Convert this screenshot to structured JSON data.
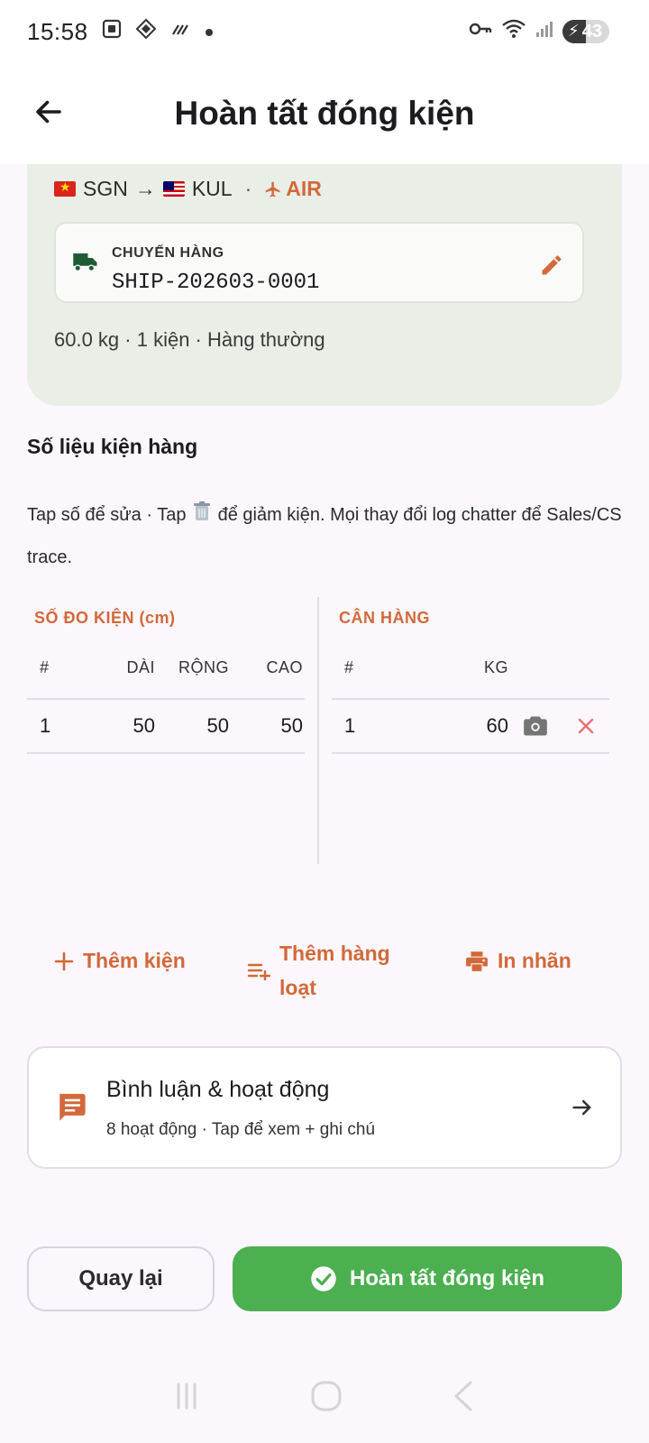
{
  "status_bar": {
    "time": "15:58",
    "battery": "43"
  },
  "header": {
    "title": "Hoàn tất đóng kiện"
  },
  "summary": {
    "origin": "SGN",
    "arrow": "→",
    "destination": "KUL",
    "separator": "·",
    "mode": "AIR",
    "shipment_label": "CHUYẾN HÀNG",
    "shipment_code": "SHIP-202603-0001",
    "summary_line": "60.0 kg · 1 kiện · Hàng thường"
  },
  "section": {
    "title": "Số liệu kiện hàng",
    "hint_before": "Tap số để sửa · Tap",
    "hint_after": "để giảm kiện. Mọi thay đổi log chatter để Sales/CS trace."
  },
  "dimensions_table": {
    "caption": "SỐ ĐO KIỆN (cm)",
    "headers": [
      "#",
      "DÀI",
      "RỘNG",
      "CAO"
    ],
    "rows": [
      {
        "idx": "1",
        "length": "50",
        "width": "50",
        "height": "50"
      }
    ]
  },
  "weight_table": {
    "caption": "CÂN HÀNG",
    "headers": [
      "#",
      "KG"
    ],
    "rows": [
      {
        "idx": "1",
        "kg": "60"
      }
    ]
  },
  "actions": {
    "add_package": "Thêm kiện",
    "bulk_add": "Thêm hàng loạt",
    "print_label": "In nhãn"
  },
  "activity": {
    "title": "Bình luận & hoạt động",
    "subtitle": "8 hoạt động · Tap để xem + ghi chú"
  },
  "footer": {
    "back_label": "Quay lại",
    "complete_label": "Hoàn tất đóng kiện"
  },
  "colors": {
    "accent": "#d2693a",
    "primary_green": "#4caf50",
    "truck_green": "#1f5c36",
    "card_bg": "#e9eee7",
    "delete_red": "#e57373"
  },
  "icons": {
    "back": "arrow-left-icon",
    "truck": "truck-icon",
    "edit": "pencil-icon",
    "camera": "camera-icon",
    "delete": "close-icon",
    "add": "plus-icon",
    "bulk": "playlist-add-icon",
    "print": "printer-icon",
    "chat": "chat-icon",
    "chevron": "arrow-right-icon",
    "check": "check-circle-icon"
  }
}
